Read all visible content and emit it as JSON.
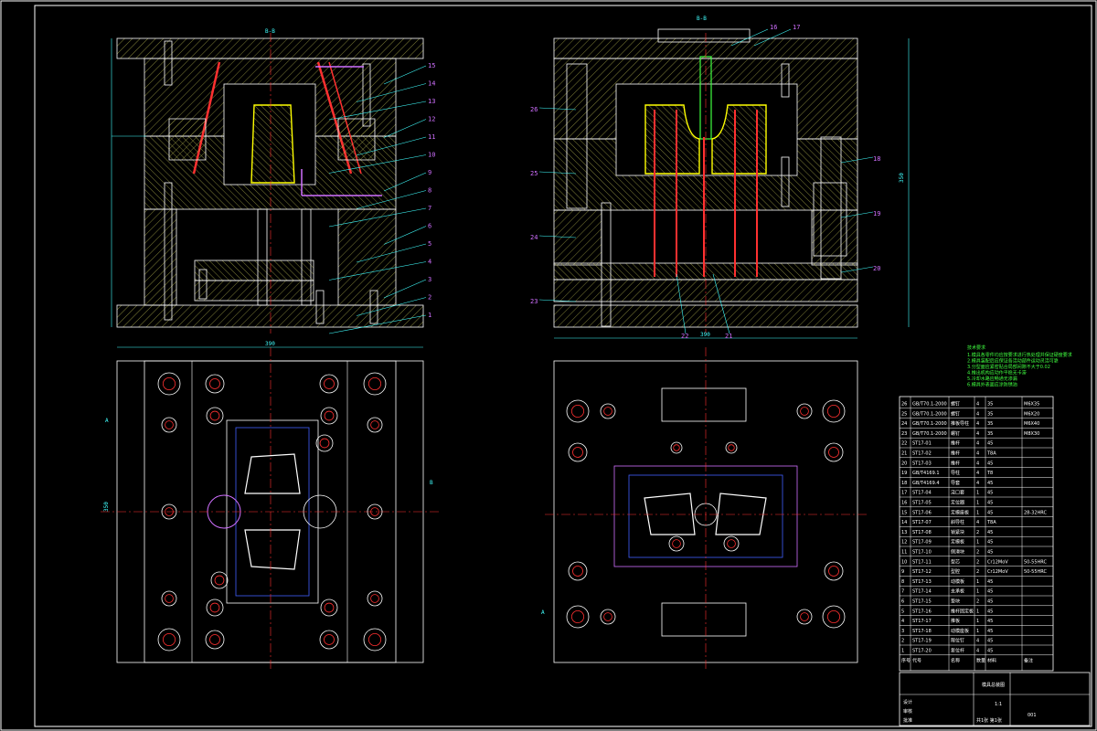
{
  "section_labels": {
    "left": "B-B",
    "right": "B-B"
  },
  "overall_dims": {
    "left_width": "390",
    "right_width": "390",
    "left_height": "350",
    "right_height": "350"
  },
  "left_callouts": [
    "15",
    "14",
    "13",
    "12",
    "11",
    "10",
    "9",
    "8",
    "7",
    "6",
    "5",
    "4",
    "3",
    "2",
    "1"
  ],
  "right_callouts_top": [
    "16",
    "17"
  ],
  "right_callouts_right": [
    "18",
    "19",
    "20"
  ],
  "right_callouts_left": [
    "26",
    "25",
    "24",
    "23"
  ],
  "right_callouts_bottom": [
    "22",
    "21"
  ],
  "view_marks": {
    "a": "A",
    "b": "B"
  },
  "tech_notes_title": "技术要求",
  "tech_notes": [
    "1.模具各零件均应按要求进行热处理并保证硬度要求",
    "2.模具装配后应保证各活动部件运动灵活可靠",
    "3.分型面应紧密贴合局部间隙不大于0.02",
    "4.推出机构应动作平稳无卡滞",
    "5.冷却水路应畅通无渗漏",
    "6.模具外表面应涂防锈油"
  ],
  "bom_rows": [
    {
      "no": "26",
      "code": "GB/T70.1-2000",
      "name": "螺钉",
      "qty": "4",
      "mat": "35",
      "note": "M6X35"
    },
    {
      "no": "25",
      "code": "GB/T70.1-2000",
      "name": "螺钉",
      "qty": "4",
      "mat": "35",
      "note": "M6X20"
    },
    {
      "no": "24",
      "code": "GB/T70.1-2000",
      "name": "推板导柱",
      "qty": "4",
      "mat": "35",
      "note": "M6X40"
    },
    {
      "no": "23",
      "code": "GB/T70.1-2000",
      "name": "螺钉",
      "qty": "4",
      "mat": "35",
      "note": "M8X30"
    },
    {
      "no": "22",
      "code": "ST17-01",
      "name": "推杆",
      "qty": "4",
      "mat": "45",
      "note": ""
    },
    {
      "no": "21",
      "code": "ST17-02",
      "name": "推杆",
      "qty": "4",
      "mat": "T8A",
      "note": ""
    },
    {
      "no": "20",
      "code": "ST17-03",
      "name": "推杆",
      "qty": "4",
      "mat": "45",
      "note": ""
    },
    {
      "no": "19",
      "code": "GB/T4169.1",
      "name": "导柱",
      "qty": "4",
      "mat": "T8",
      "note": ""
    },
    {
      "no": "18",
      "code": "GB/T4169.4",
      "name": "导套",
      "qty": "4",
      "mat": "45",
      "note": ""
    },
    {
      "no": "17",
      "code": "ST17-04",
      "name": "浇口套",
      "qty": "1",
      "mat": "45",
      "note": ""
    },
    {
      "no": "16",
      "code": "ST17-05",
      "name": "定位圈",
      "qty": "1",
      "mat": "45",
      "note": ""
    },
    {
      "no": "15",
      "code": "ST17-06",
      "name": "定模座板",
      "qty": "1",
      "mat": "45",
      "note": "28-32HRC"
    },
    {
      "no": "14",
      "code": "ST17-07",
      "name": "斜导柱",
      "qty": "4",
      "mat": "T8A",
      "note": ""
    },
    {
      "no": "13",
      "code": "ST17-08",
      "name": "锁紧块",
      "qty": "2",
      "mat": "45",
      "note": ""
    },
    {
      "no": "12",
      "code": "ST17-09",
      "name": "定模板",
      "qty": "1",
      "mat": "45",
      "note": ""
    },
    {
      "no": "11",
      "code": "ST17-10",
      "name": "侧滑块",
      "qty": "2",
      "mat": "45",
      "note": ""
    },
    {
      "no": "10",
      "code": "ST17-11",
      "name": "型芯",
      "qty": "2",
      "mat": "Cr12MoV",
      "note": "50-55HRC"
    },
    {
      "no": "9",
      "code": "ST17-12",
      "name": "型腔",
      "qty": "2",
      "mat": "Cr12MoV",
      "note": "50-55HRC"
    },
    {
      "no": "8",
      "code": "ST17-13",
      "name": "动模板",
      "qty": "1",
      "mat": "45",
      "note": ""
    },
    {
      "no": "7",
      "code": "ST17-14",
      "name": "支承板",
      "qty": "1",
      "mat": "45",
      "note": ""
    },
    {
      "no": "6",
      "code": "ST17-15",
      "name": "垫块",
      "qty": "2",
      "mat": "45",
      "note": ""
    },
    {
      "no": "5",
      "code": "ST17-16",
      "name": "推杆固定板",
      "qty": "1",
      "mat": "45",
      "note": ""
    },
    {
      "no": "4",
      "code": "ST17-17",
      "name": "推板",
      "qty": "1",
      "mat": "45",
      "note": ""
    },
    {
      "no": "3",
      "code": "ST17-18",
      "name": "动模座板",
      "qty": "1",
      "mat": "45",
      "note": ""
    },
    {
      "no": "2",
      "code": "ST17-19",
      "name": "限位钉",
      "qty": "4",
      "mat": "45",
      "note": ""
    },
    {
      "no": "1",
      "code": "ST17-20",
      "name": "复位杆",
      "qty": "4",
      "mat": "45",
      "note": ""
    }
  ],
  "bom_header": {
    "no": "序号",
    "code": "代号",
    "name": "名称",
    "qty": "数量",
    "mat": "材料",
    "note": "备注"
  },
  "title_block": {
    "drawing_name": "模具总装图",
    "drawing_no": "001",
    "scale": "1:1",
    "sheet": "共1张 第1张",
    "designer": "设计",
    "checker": "审核",
    "approver": "批准"
  },
  "colors": {
    "outline": "#ffffff",
    "hatch": "#c8c850",
    "red": "#ff3030",
    "cyan": "#40ffff",
    "magenta": "#d070ff",
    "yellow": "#ffff00",
    "green": "#40ff40",
    "blue": "#4060ff"
  }
}
